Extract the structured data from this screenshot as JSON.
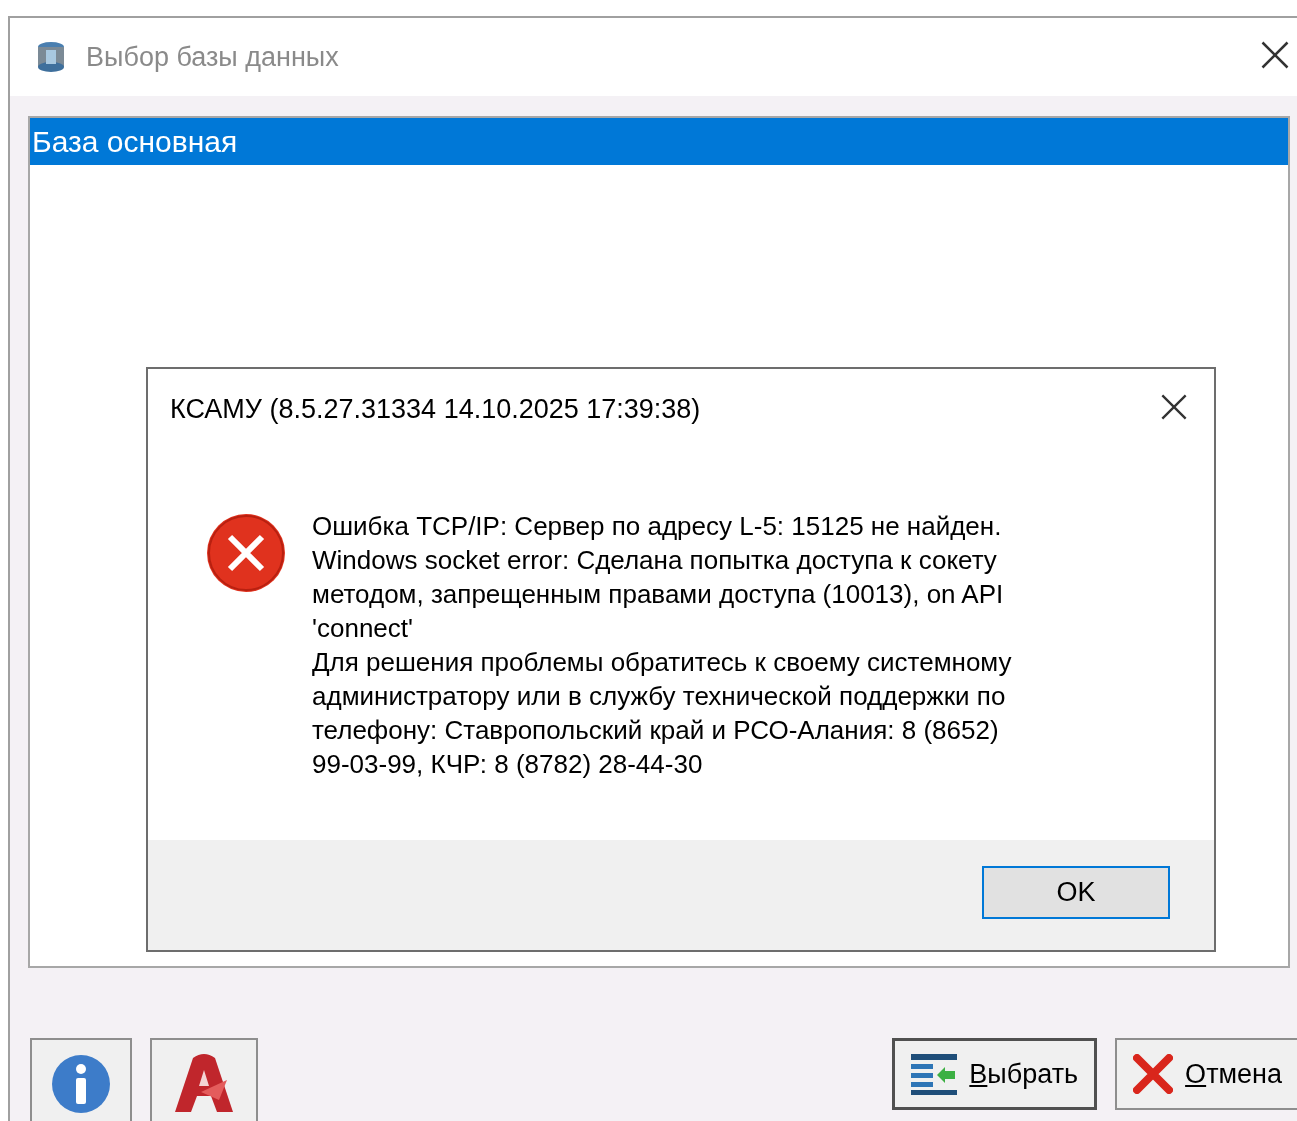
{
  "window": {
    "title": "Выбор базы данных"
  },
  "databases": [
    {
      "name": "База основная",
      "selected": true
    }
  ],
  "dialog": {
    "title": "КСАМУ (8.5.27.31334 14.10.2025 17:39:38)",
    "kind": "error",
    "message_lines": [
      "Ошибка TCP/IP: Сервер по адресу L-5: 15125 не найден.",
      "Windows socket error: Сделана попытка доступа к сокету",
      "методом, запрещенным правами доступа (10013), on API",
      "'connect'",
      "Для решения проблемы обратитесь к своему системному",
      "администратору или в службу технической поддержки по",
      "телефону: Ставропольский край и РСО-Алания: 8 (8652)",
      "99-03-99, КЧР: 8 (8782) 28-44-30"
    ],
    "button": "OK"
  },
  "buttons": [
    {
      "kind": "select",
      "label": "Выбрать",
      "default": true
    },
    {
      "kind": "cancel",
      "label": "Отмена",
      "default": false
    }
  ]
}
